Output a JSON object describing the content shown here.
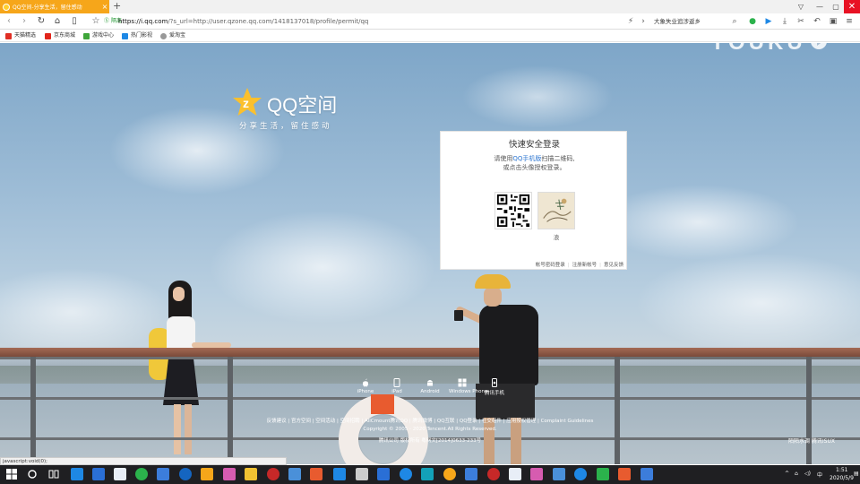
{
  "browser": {
    "tab_title": "QQ空间-分享生活，留住感动",
    "new_tab": "+",
    "window_controls": [
      "shirt-icon",
      "minimize-icon",
      "restore-icon",
      "close-icon"
    ],
    "secure_label": "Ⓢ 隔离",
    "url_domain": "https://i.qq.com",
    "url_rest": "/?s_url=http://user.qzone.qq.com/1418137018/profile/permit/qq",
    "search_text": "大象失业追涉返乡",
    "bookmarks": [
      "天猫精选",
      "京东商城",
      "游戏中心",
      "热门影视",
      "爱淘宝"
    ]
  },
  "page": {
    "logo_text": "QQ空间",
    "slogan": "分享生活，留住感动",
    "watermark": "YOUKU",
    "login": {
      "title": "快速安全登录",
      "desc_prefix": "请使用",
      "desc_link": "QQ手机版",
      "desc_suffix": "扫描二维码,",
      "desc_line2": "或点击头像授权登录。",
      "avatar_name": "浪",
      "footer": [
        "帐号密码登录",
        "注册新帐号",
        "意见反馈"
      ]
    },
    "platforms": [
      "iPhone",
      "iPad",
      "Android",
      "Windows Phone",
      "腾讯手机"
    ],
    "footer_links": "反馈建议 | 官方空间 | 空间活动 | 空间招聘 | AllCmount腾讯QQ | 腾讯微博 | QQ互联 | QQ登录 | 社交组件 | 应用授权管理 | Complaint Guidelines",
    "copyright": "Copyright © 2005 - 2020 Tencent.All Rights Reserved.",
    "copyright2": "腾讯公司 版权所有 粤网文[2014]0633-233号",
    "bottom_right": "陌陌水调  腾讯ISUX",
    "status_text": "javascript:void(0);"
  },
  "taskbar": {
    "time": "1:51",
    "date": "2020/5/9",
    "lang": "中"
  },
  "colors": {
    "tab": "#f6a61a",
    "link": "#2f77d1",
    "close": "#e81123"
  }
}
